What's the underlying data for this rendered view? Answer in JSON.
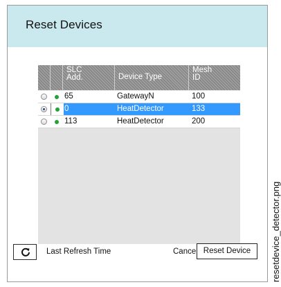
{
  "dialog": {
    "title": "Reset Devices",
    "header_color": "#c9e9ef"
  },
  "table": {
    "columns": [
      {
        "label": ""
      },
      {
        "label": ""
      },
      {
        "label_line1": "SLC",
        "label_line2": "Add."
      },
      {
        "label": "Device Type"
      },
      {
        "label_line1": "Mesh",
        "label_line2": "ID"
      }
    ],
    "rows": [
      {
        "selected": false,
        "status_icon": "green-dot-icon",
        "slc": "65",
        "device_type": "GatewayN",
        "mesh_id": "100"
      },
      {
        "selected": true,
        "status_icon": "green-dot-icon",
        "slc": "0",
        "device_type": "HeatDetector",
        "mesh_id": "133"
      },
      {
        "selected": false,
        "status_icon": "green-dot-icon",
        "slc": "113",
        "device_type": "HeatDetector",
        "mesh_id": "200"
      }
    ],
    "selected_row_color": "#3399ff",
    "status_color": "#21a336"
  },
  "footer": {
    "refresh_icon": "refresh-icon",
    "refresh_label": "Last Refresh Time",
    "cancel_label": "Cancel",
    "reset_label": "Reset Device"
  },
  "caption": "resetdevice_detector.png"
}
